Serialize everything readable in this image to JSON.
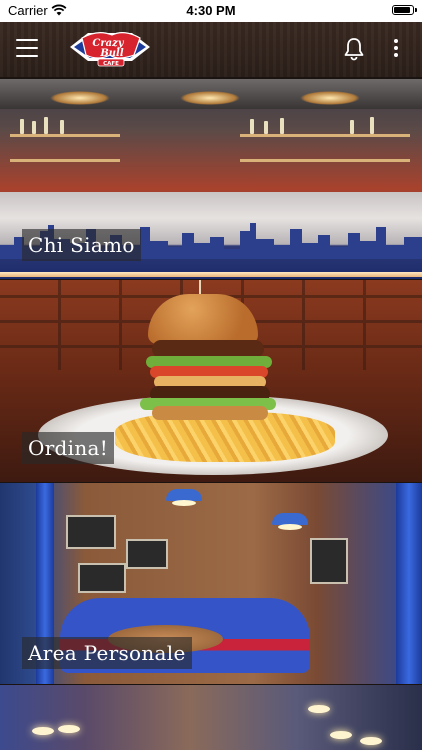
{
  "status_bar": {
    "carrier": "Carrier",
    "time": "4:30 PM"
  },
  "navbar": {
    "logo_line1": "Crazy",
    "logo_line2": "Bull",
    "logo_line3": "CAFE",
    "icons": [
      "menu-icon",
      "notification-bell-icon",
      "more-vertical-icon"
    ]
  },
  "tiles": [
    {
      "label": "Chi Siamo"
    },
    {
      "label": "Ordina!"
    },
    {
      "label": "Area Personale"
    },
    {
      "label": ""
    }
  ],
  "colors": {
    "navbar": "#2b1f19",
    "label_bg": "#282828",
    "label_text": "#ffffff",
    "logo_red": "#d6232e",
    "logo_blue": "#1e3d9b"
  }
}
